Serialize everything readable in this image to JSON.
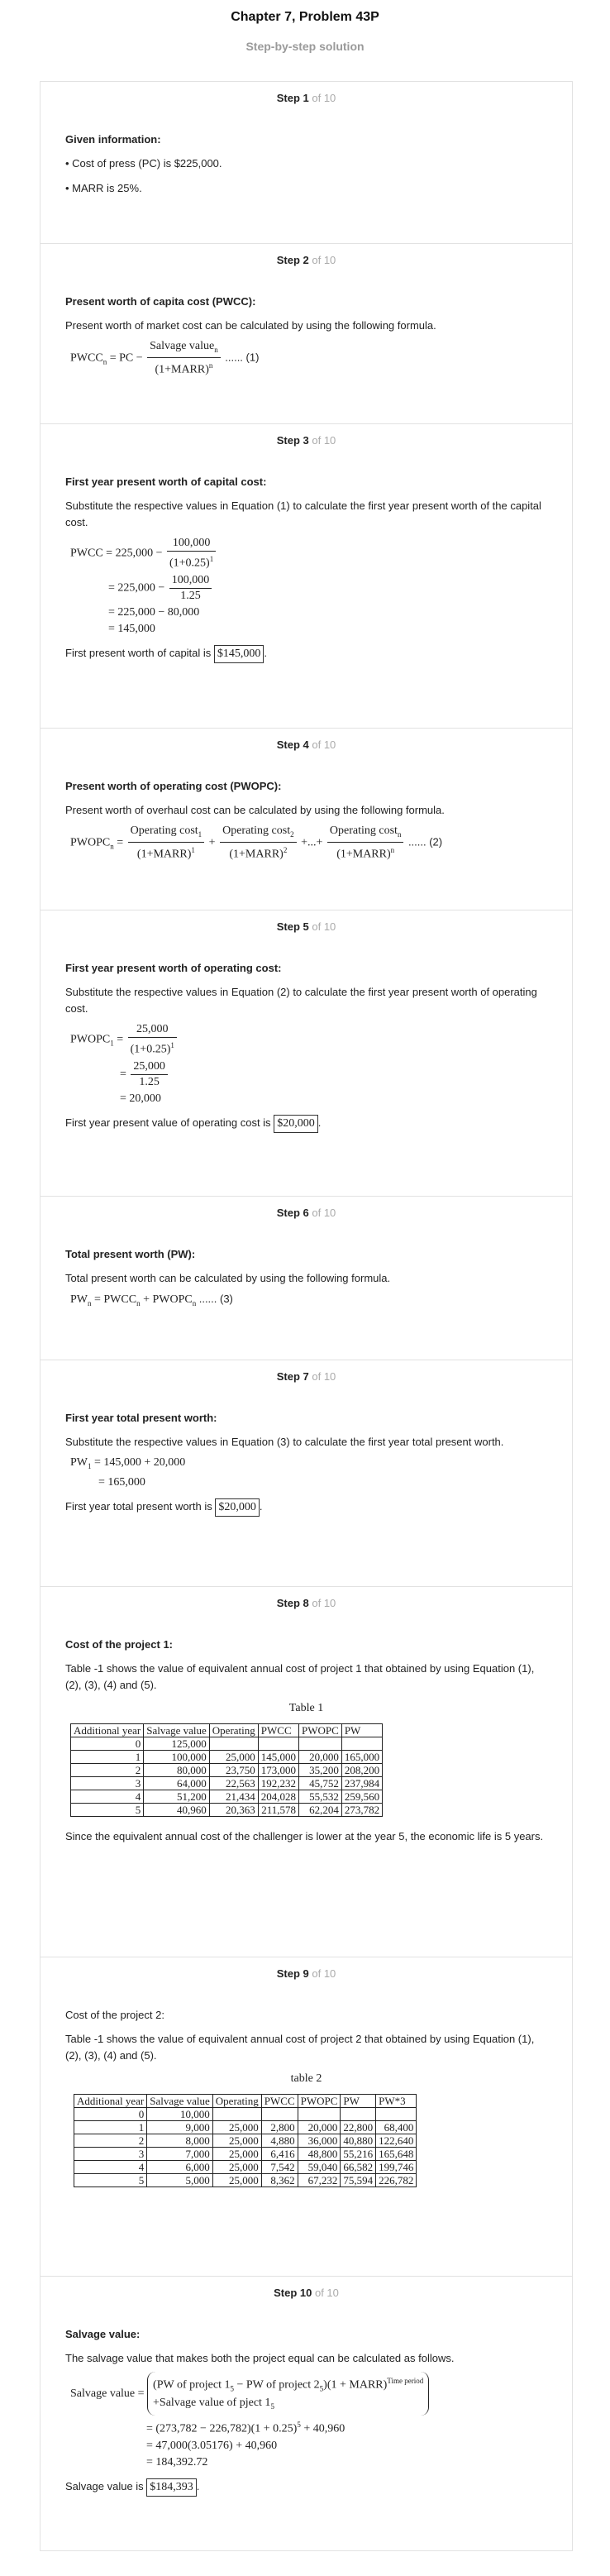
{
  "header": {
    "title": "Chapter 7, Problem 43P",
    "subtitle": "Step-by-step solution"
  },
  "step_total_text": "of 10",
  "steps": [
    {
      "label": "Step 1",
      "heading": "Given information:",
      "bullets": [
        "• Cost of press (PC) is $225,000.",
        "• MARR is 25%."
      ]
    },
    {
      "label": "Step 2",
      "heading": "Present worth of capita cost (PWCC):",
      "text": "Present worth of market cost can be calculated by using the following formula.",
      "eq_tag": "...... (1)"
    },
    {
      "label": "Step 3",
      "heading": "First year present worth of capital cost:",
      "text": "Substitute the respective values in Equation (1) to calculate the first year present worth of the capital cost.",
      "lines": [
        "= 225,000 − 80,000",
        "= 145,000"
      ],
      "result_text": "First present worth of capital is",
      "result_value": "$145,000"
    },
    {
      "label": "Step 4",
      "heading": "Present worth of operating cost (PWOPC):",
      "text": "Present worth of overhaul cost can be calculated by using the following formula.",
      "eq_tag": "...... (2)"
    },
    {
      "label": "Step 5",
      "heading": "First year present worth of operating cost:",
      "text": "Substitute the respective values in Equation (2) to calculate the first year present worth of operating cost.",
      "lines": [
        "= 20,000"
      ],
      "result_text": "First year present value of operating cost is",
      "result_value": "$20,000"
    },
    {
      "label": "Step 6",
      "heading": "Total present worth (PW):",
      "text": "Total present worth can be calculated by using the following formula.",
      "eq_tag": "...... (3)"
    },
    {
      "label": "Step 7",
      "heading": "First year total present worth:",
      "text": "Substitute the respective values in Equation (3) to calculate the first year total present worth.",
      "lines": [
        "= 165,000"
      ],
      "result_text": "First year total present worth is",
      "result_value": "$20,000"
    },
    {
      "label": "Step 8",
      "heading": "Cost of the project 1:",
      "text": "Table -1 shows the value of equivalent annual cost of project 1 that obtained by using Equation (1), (2), (3), (4) and (5).",
      "caption": "Table 1",
      "note": "Since the equivalent annual cost of the challenger is lower at the year 5, the economic life is 5 years."
    },
    {
      "label": "Step 9",
      "heading": "Cost of the project 2:",
      "text": "Table -1 shows the value of equivalent annual cost of project 2 that obtained by using Equation (1), (2), (3), (4) and (5).",
      "caption": "table 2"
    },
    {
      "label": "Step 10",
      "heading": "Salvage value:",
      "text": "The salvage value that makes both the project equal can be calculated as follows.",
      "lines": [
        "= (273,782 − 226,782)(1 + 0.25)<sup>5</sup> + 40,960",
        "= 47,000(3.05176) + 40,960",
        "= 184,392.72"
      ],
      "result_text": "Salvage value is",
      "result_value": "$184,393"
    }
  ],
  "table1": {
    "headers": [
      "Additional year",
      "Salvage value",
      "Operating",
      "PWCC",
      "PWOPC",
      "PW"
    ],
    "rows": [
      [
        "0",
        "125,000",
        "",
        "",
        "",
        ""
      ],
      [
        "1",
        "100,000",
        "25,000",
        "145,000",
        "20,000",
        "165,000"
      ],
      [
        "2",
        "80,000",
        "23,750",
        "173,000",
        "35,200",
        "208,200"
      ],
      [
        "3",
        "64,000",
        "22,563",
        "192,232",
        "45,752",
        "237,984"
      ],
      [
        "4",
        "51,200",
        "21,434",
        "204,028",
        "55,532",
        "259,560"
      ],
      [
        "5",
        "40,960",
        "20,363",
        "211,578",
        "62,204",
        "273,782"
      ]
    ]
  },
  "table2": {
    "headers": [
      "Additional year",
      "Salvage value",
      "Operating",
      "PWCC",
      "PWOPC",
      "PW",
      "PW*3"
    ],
    "rows": [
      [
        "0",
        "10,000",
        "",
        "",
        "",
        "",
        ""
      ],
      [
        "1",
        "9,000",
        "25,000",
        "2,800",
        "20,000",
        "22,800",
        "68,400"
      ],
      [
        "2",
        "8,000",
        "25,000",
        "4,880",
        "36,000",
        "40,880",
        "122,640"
      ],
      [
        "3",
        "7,000",
        "25,000",
        "6,416",
        "48,800",
        "55,216",
        "165,648"
      ],
      [
        "4",
        "6,000",
        "25,000",
        "7,542",
        "59,040",
        "66,582",
        "199,746"
      ],
      [
        "5",
        "5,000",
        "25,000",
        "8,362",
        "67,232",
        "75,594",
        "226,782"
      ]
    ]
  }
}
